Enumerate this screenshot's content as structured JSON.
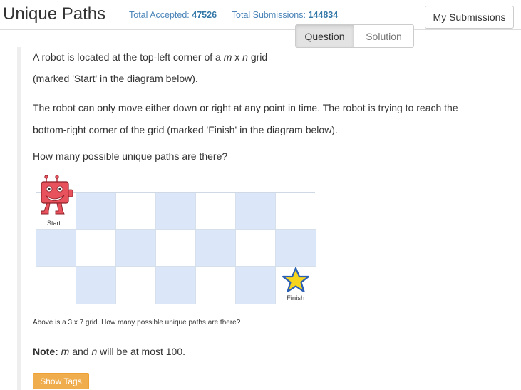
{
  "header": {
    "title": "Unique Paths",
    "accepted_label": "Total Accepted:",
    "accepted_value": "47526",
    "submissions_label": "Total Submissions:",
    "submissions_value": "144834",
    "my_submissions": "My Submissions"
  },
  "tabs": [
    {
      "label": "Question",
      "active": true
    },
    {
      "label": "Solution",
      "active": false
    }
  ],
  "problem": {
    "line1_pre": "A robot is located at the top-left corner of a ",
    "m": "m",
    "x1": " x ",
    "n": "n",
    "line1_post": " grid",
    "line2": "(marked 'Start' in the diagram below).",
    "line3": "The robot can only move either down or right at any point in time. The robot is trying to reach the",
    "line4": "bottom-right corner of the grid (marked 'Finish' in the diagram below).",
    "line5": "How many possible unique paths are there?"
  },
  "diagram": {
    "start_label": "Start",
    "finish_label": "Finish",
    "rows": 3,
    "cols": 7,
    "caption": "Above is a 3 x 7 grid. How many possible unique paths are there?"
  },
  "note": {
    "label": "Note:",
    "m": "m",
    "and": " and ",
    "n": "n",
    "rest": " will be at most 100."
  },
  "show_tags": "Show Tags",
  "colors": {
    "accent_blue": "#3478a8",
    "grid_blue": "#dbe7f8",
    "tags_orange": "#f0ad4e",
    "star_yellow": "#f7d51d",
    "robot_red": "#e8525c"
  },
  "icons": {
    "robot": "robot-icon",
    "star": "star-icon"
  }
}
